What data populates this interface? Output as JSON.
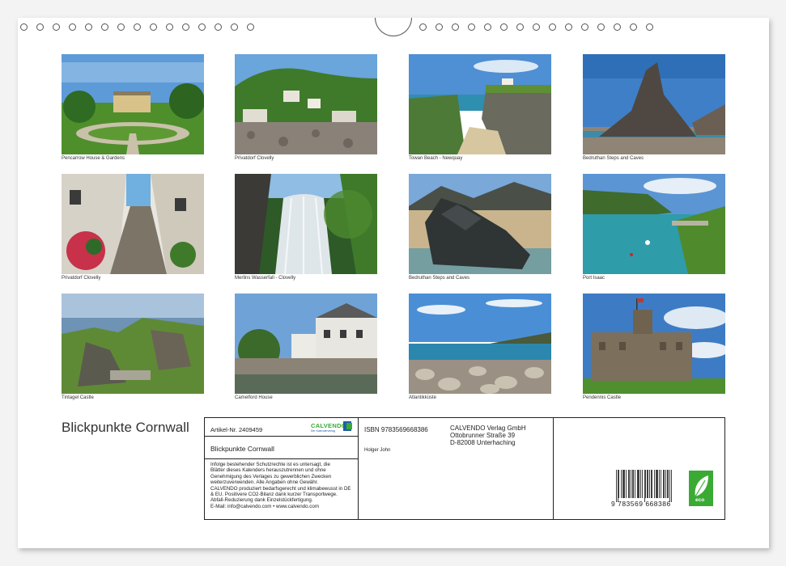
{
  "calendar": {
    "title": "Blickpunkte Cornwall"
  },
  "photos": [
    {
      "caption": "Pencarrow House & Gardens",
      "scene": "estate-garden"
    },
    {
      "caption": "Privatdorf Clovelly",
      "scene": "village-harbour"
    },
    {
      "caption": "Towan Beach - Newquay",
      "scene": "beach-cliffs"
    },
    {
      "caption": "Bedruthan Steps and Caves",
      "scene": "sea-stack"
    },
    {
      "caption": "Privatdorf Clovelly",
      "scene": "village-lane"
    },
    {
      "caption": "Merlins Wasserfall - Clovelly",
      "scene": "waterfall"
    },
    {
      "caption": "Bedruthan Steps and Caves",
      "scene": "rock-beach"
    },
    {
      "caption": "Port Isaac",
      "scene": "harbour-bay"
    },
    {
      "caption": "Tintagel Castle",
      "scene": "headland"
    },
    {
      "caption": "Camelford House",
      "scene": "town-river"
    },
    {
      "caption": "Atlantikküste",
      "scene": "pebble-beach"
    },
    {
      "caption": "Pendennis Castle",
      "scene": "castle"
    }
  ],
  "info": {
    "article_label": "Artikel-Nr. 2409459",
    "brand_name": "CALVENDO",
    "brand_tagline": "Der Kalenderverlag",
    "calendar_name": "Blickpunkte Cornwall",
    "legal_text": "Infolge bestehender Schutzrechte ist es untersagt, die\nBlätter dieses Kalenders herauszutrennen und ohne\nGenehmigung des Verlages zu gewerblichen Zwecken\nweiterzuverwenden. Alle Angaben ohne Gewähr.\nCALVENDO produziert bedarfsgerecht und klimabewusst in DE\n& EU. Positivere CO2-Bilanz dank kurzer Transportwege.\nAbfall-Reduzierung dank Einzelstückfertigung.\nE-Mail: info@calvendo.com • www.calvendo.com",
    "isbn": "ISBN 9783569668386",
    "author": "Holger John",
    "publisher_name": "CALVENDO Verlag GmbH",
    "publisher_street": "Ottobrunner Straße 39",
    "publisher_city": "D-82008 Unterhaching",
    "barcode_number": "9 783569 668386",
    "eco_label": "eco"
  },
  "colors": {
    "brand_green": "#3aaa35",
    "brand_blue": "#1f5fa8",
    "sky": "#4a86c8",
    "grass": "#4f8a2c",
    "rock": "#5a5048",
    "sea": "#2e8fb0"
  }
}
